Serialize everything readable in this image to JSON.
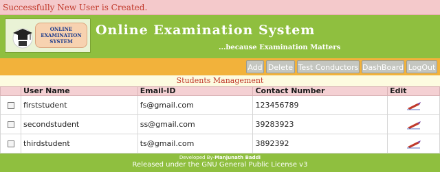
{
  "flash": {
    "message": "Successfully New User is Created."
  },
  "logo": {
    "line1": "ONLINE",
    "line2": "EXAMINATION",
    "line3": "SYSTEM"
  },
  "header": {
    "title": "Online Examination System",
    "tagline": "...because Examination Matters"
  },
  "nav": {
    "items": [
      {
        "label": "Add"
      },
      {
        "label": "Delete"
      },
      {
        "label": "Test Conductors"
      },
      {
        "label": "DashBoard"
      },
      {
        "label": "LogOut"
      }
    ]
  },
  "section": {
    "title": "Students Management"
  },
  "table": {
    "headers": [
      "",
      "User Name",
      "Email-ID",
      "Contact Number",
      "Edit"
    ],
    "rows": [
      {
        "username": "firststudent",
        "email": "fs@gmail.com",
        "contact": "123456789"
      },
      {
        "username": "secondstudent",
        "email": "ss@gmail.com",
        "contact": "39283923"
      },
      {
        "username": "thirdstudent",
        "email": "ts@gmail.com",
        "contact": "3892392"
      }
    ]
  },
  "footer": {
    "developed_by_prefix": "Developed By-",
    "developer": "Manjunath Baddi",
    "license": "Released under the GNU General Public License v3"
  },
  "colors": {
    "background": "#8fbf3f",
    "navbar": "#f2b23b",
    "flash_bg": "#f4c9cb",
    "flash_text": "#c0392b",
    "table_header": "#f4d0d3"
  }
}
